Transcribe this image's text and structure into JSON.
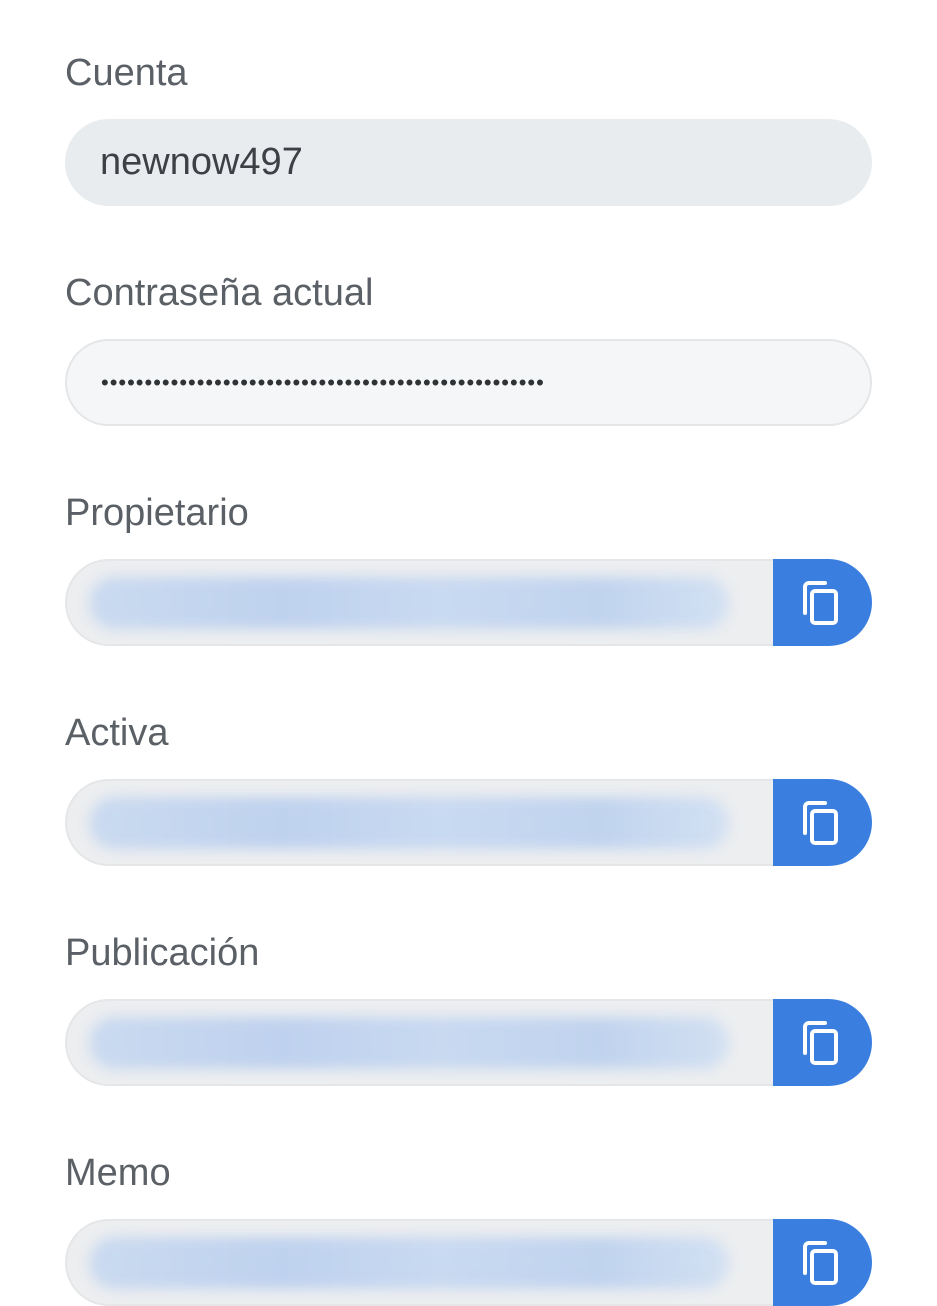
{
  "fields": {
    "account": {
      "label": "Cuenta",
      "value": "newnow497"
    },
    "current_password": {
      "label": "Contraseña actual",
      "value": "•••••••••••••••••••••••••••••••••••••••••••••••••••"
    },
    "owner": {
      "label": "Propietario"
    },
    "active": {
      "label": "Activa"
    },
    "posting": {
      "label": "Publicación"
    },
    "memo": {
      "label": "Memo"
    }
  },
  "icons": {
    "copy": "copy-icon"
  },
  "colors": {
    "accent": "#3a7fe0",
    "label": "#5a6065",
    "field_bg": "#e9ecee"
  }
}
